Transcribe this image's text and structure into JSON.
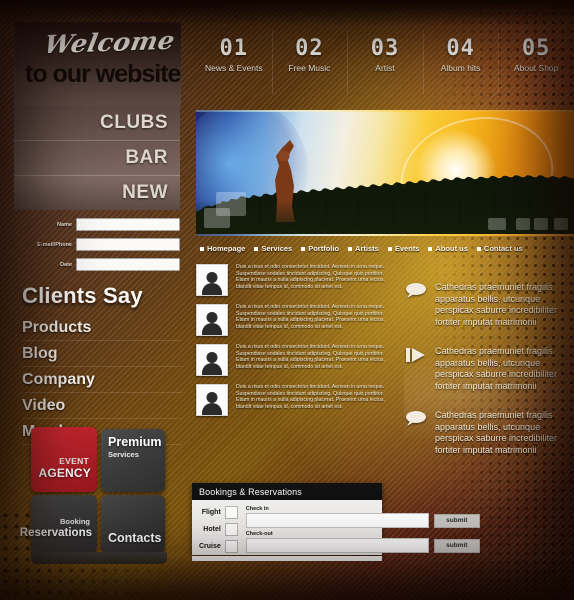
{
  "header": {
    "welcome_script": "Welcome",
    "welcome_sub": "to our website"
  },
  "topnav": {
    "items": [
      {
        "num": "01",
        "caption": "News & Events"
      },
      {
        "num": "02",
        "caption": "Free Music"
      },
      {
        "num": "03",
        "caption": "Artist"
      },
      {
        "num": "04",
        "caption": "Album hits"
      },
      {
        "num": "05",
        "caption": "About Shop"
      }
    ]
  },
  "left_menu": {
    "items": [
      "CLUBS",
      "BAR",
      "NEW"
    ]
  },
  "left_form": {
    "fields": [
      {
        "label": "Name",
        "value": "",
        "placeholder": ""
      },
      {
        "label": "E-mail/Phone",
        "value": "",
        "placeholder": ""
      },
      {
        "label": "Date",
        "value": "",
        "placeholder": ""
      }
    ]
  },
  "clients": {
    "title": "Clients Say",
    "items": [
      "Products",
      "Blog",
      "Company",
      "Video",
      "Members"
    ]
  },
  "tiles": {
    "agency": {
      "small": "EVENT",
      "big": "AGENCY",
      "color": "#c22630"
    },
    "premium": {
      "big": "Premium",
      "small": "Services",
      "color": "#3b3b3b"
    },
    "booking": {
      "small": "Booking",
      "big": "Reservations",
      "color": "#3a3a3a"
    },
    "contacts": {
      "big": "Contacts",
      "color": "#383838"
    }
  },
  "crumbs": {
    "items": [
      "Homepage",
      "Services",
      "Portfolio",
      "Artists",
      "Events",
      "About us",
      "Contact us"
    ]
  },
  "center": {
    "paragraph": "Duis a risus et odio consectetur tincidunt. Aenean in urna neque. Suspendisse sodales tincidunt adipiscing. Quisque quis porttitor. Etiam in mauris a nulla adipiscing placerat. Praesent urna lectus, blandit vitae tempus id, commodo sit amet est.",
    "rows": [
      {
        "icon": "person-avatar-icon"
      },
      {
        "icon": "person-avatar-icon"
      },
      {
        "icon": "person-avatar-icon"
      },
      {
        "icon": "person-avatar-icon"
      }
    ]
  },
  "right": {
    "blocks": [
      {
        "icon": "speech-bubble-icon",
        "text": "Cathedras praemuniet fragilis apparatus bellis, utcunque perspicax saburre incredibiliter fortiter imputat matrimonii"
      },
      {
        "icon": "play-triangle-icon",
        "text": "Cathedras praemuniet fragilis apparatus bellis, utcunque perspicax saburre incredibiliter fortiter imputat matrimonii"
      },
      {
        "icon": "speech-bubble-icon",
        "text": "Cathedras praemuniet fragilis apparatus bellis, utcunque perspicax saburre incredibiliter fortiter imputat matrimonii"
      }
    ]
  },
  "bookings": {
    "title": "Bookings & Reservations",
    "options": [
      {
        "label": "Flight",
        "checked": false
      },
      {
        "label": "Hotel",
        "checked": false
      },
      {
        "label": "Cruise",
        "checked": false
      }
    ],
    "checkin_label": "Check in",
    "checkin_value": "",
    "checkout_label": "Check-out",
    "checkout_value": "",
    "submit_label_1": "submit",
    "submit_label_2": "submit"
  },
  "hero": {
    "alt": "concert-crowd-banner"
  }
}
